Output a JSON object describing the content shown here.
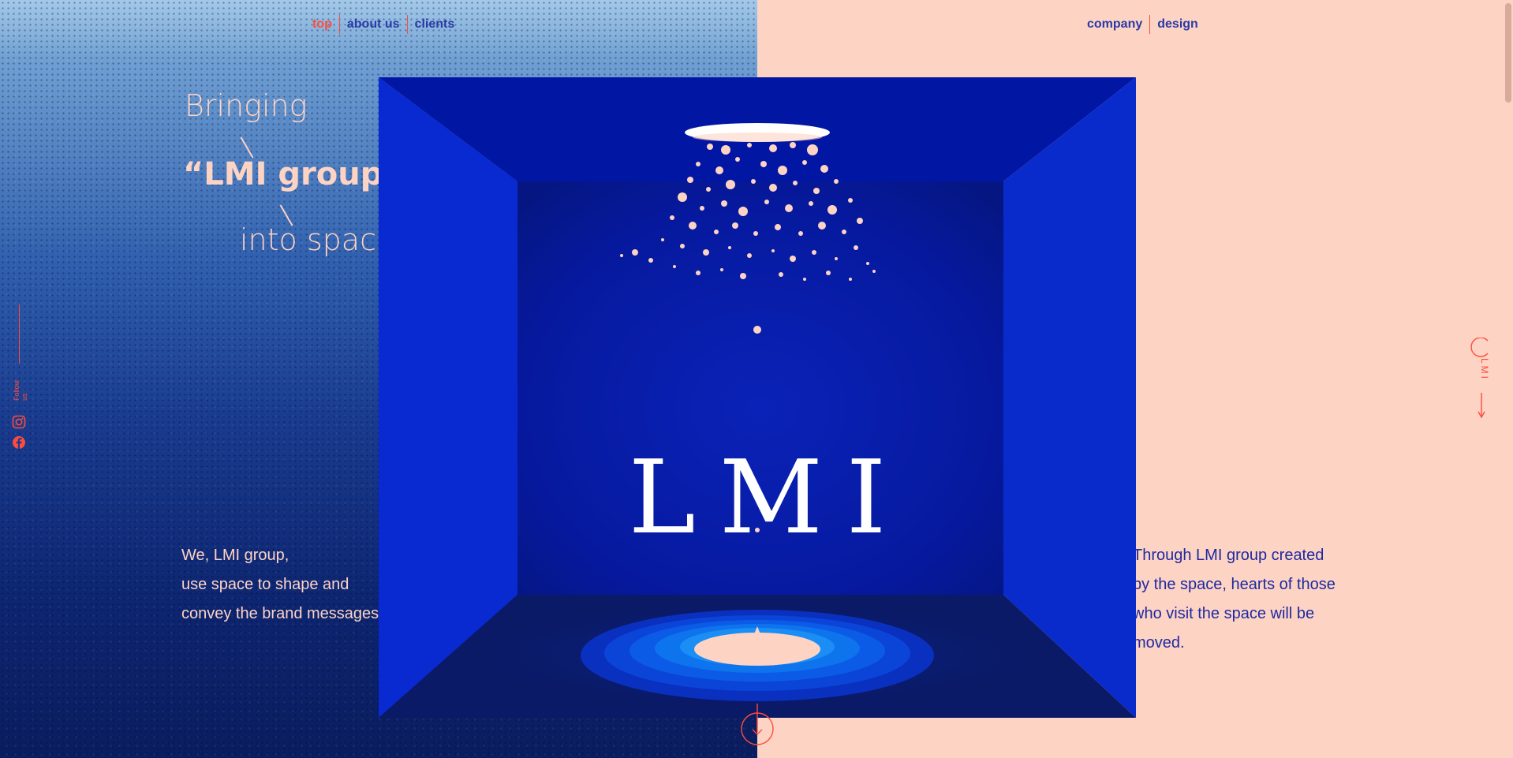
{
  "nav_left": [
    {
      "label": "top",
      "active": true
    },
    {
      "label": "about us",
      "active": false
    },
    {
      "label": "clients",
      "active": false
    }
  ],
  "nav_right": [
    {
      "label": "company"
    },
    {
      "label": "design"
    }
  ],
  "headline": {
    "line1": "Bringing",
    "line2": "“LMI group”",
    "line3": "into space"
  },
  "intro_left": [
    "We, LMI group,",
    "use space to shape and",
    "convey the brand messages."
  ],
  "intro_right": [
    "Through LMI group created",
    "by the space, hearts of those",
    "who visit the space will be",
    "moved."
  ],
  "social": {
    "follow_label": "Follow us",
    "icons": [
      "instagram-icon",
      "facebook-icon"
    ]
  },
  "side_tab": {
    "label": "LMI",
    "icon": "arrow-right-icon"
  },
  "logo_text": "LMI",
  "scroll_button": {
    "icon": "chevron-down-icon"
  },
  "colors": {
    "accent": "#ff4b3c",
    "nav_text": "#2a3aa6",
    "peach": "#fdd3c4",
    "royal_blue": "#0a22b8"
  }
}
